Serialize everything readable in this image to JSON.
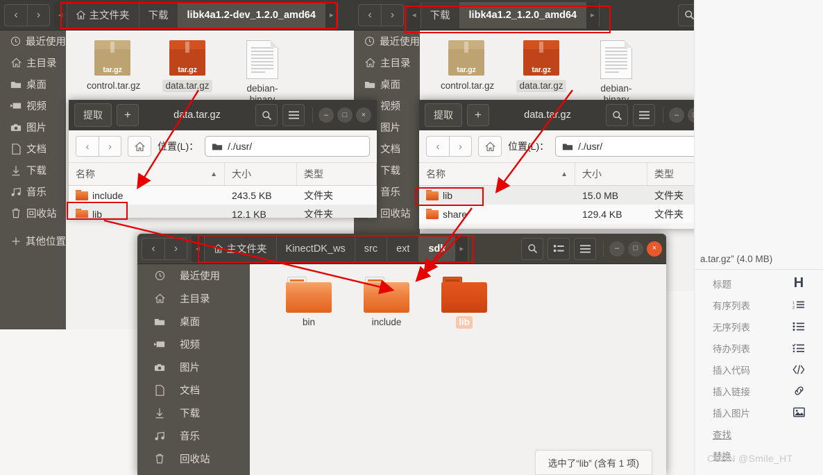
{
  "window_left": {
    "breadcrumbs": [
      {
        "label": "主文件夹",
        "icon": "home-icon",
        "current": false
      },
      {
        "label": "下载",
        "icon": null,
        "current": false
      },
      {
        "label": "libk4a1.2-dev_1.2.0_amd64",
        "icon": null,
        "current": true
      }
    ],
    "nav": {
      "back": "‹",
      "forward": "›",
      "prev_crumb": "◂",
      "next_crumb": "▸"
    },
    "sidebar": [
      {
        "label": "最近使用",
        "icon": "clock-icon"
      },
      {
        "label": "主目录",
        "icon": "home-icon"
      },
      {
        "label": "桌面",
        "icon": "folder-icon"
      },
      {
        "label": "视频",
        "icon": "video-icon"
      },
      {
        "label": "图片",
        "icon": "camera-icon"
      },
      {
        "label": "文档",
        "icon": "document-icon"
      },
      {
        "label": "下载",
        "icon": "download-icon"
      },
      {
        "label": "音乐",
        "icon": "music-icon"
      },
      {
        "label": "回收站",
        "icon": "trash-icon"
      },
      {
        "label": "其他位置",
        "icon": "plus-icon"
      }
    ],
    "files": [
      {
        "label": "control.tar.gz",
        "icon": "targz-tan-icon",
        "badge": "tar.gz",
        "selected": false
      },
      {
        "label": "data.tar.gz",
        "icon": "targz-red-icon",
        "badge": "tar.gz",
        "selected": true
      },
      {
        "label": "debian-binary",
        "icon": "text-document-icon",
        "badge": "",
        "selected": false
      }
    ]
  },
  "window_right": {
    "breadcrumbs": [
      {
        "label": "下载",
        "icon": null,
        "current": false
      },
      {
        "label": "libk4a1.2_1.2.0_amd64",
        "icon": null,
        "current": true
      }
    ],
    "nav": {
      "back": "‹",
      "forward": "›",
      "prev_crumb": "◂",
      "next_crumb": "▸"
    },
    "toolbar": {
      "search": "search-icon",
      "view": "list-view-icon",
      "menu": "hamburger-icon"
    },
    "controls": {
      "minimize": "–",
      "maximize": "□",
      "close": "×"
    },
    "sidebar": [
      {
        "label": "最近使用",
        "icon": "clock-icon"
      },
      {
        "label": "主目录",
        "icon": "home-icon"
      },
      {
        "label": "桌面",
        "icon": "folder-icon"
      },
      {
        "label": "视频",
        "icon": "video-icon"
      },
      {
        "label": "图片",
        "icon": "camera-icon"
      },
      {
        "label": "文档",
        "icon": "document-icon"
      },
      {
        "label": "下载",
        "icon": "download-icon"
      },
      {
        "label": "音乐",
        "icon": "music-icon"
      },
      {
        "label": "回收站",
        "icon": "trash-icon"
      }
    ],
    "files": [
      {
        "label": "control.tar.gz",
        "icon": "targz-tan-icon",
        "badge": "tar.gz",
        "selected": false
      },
      {
        "label": "data.tar.gz",
        "icon": "targz-red-icon",
        "badge": "tar.gz",
        "selected": true
      },
      {
        "label": "debian-binary",
        "icon": "text-document-icon",
        "badge": "",
        "selected": false
      }
    ]
  },
  "archive_left": {
    "title": "data.tar.gz",
    "extract_label": "提取",
    "add_label": "+",
    "search_icon": "search-icon",
    "menu_icon": "hamburger-icon",
    "controls": {
      "minimize": "–",
      "maximize": "□",
      "close": "×"
    },
    "location_label": "位置(L)：",
    "location_value": "/./usr/",
    "columns": {
      "name": "名称",
      "size": "大小",
      "type": "类型",
      "sort": "▲"
    },
    "rows": [
      {
        "name": "include",
        "size": "243.5 KB",
        "type": "文件夹",
        "selected": false
      },
      {
        "name": "lib",
        "size": "12.1 KB",
        "type": "文件夹",
        "selected": true
      }
    ]
  },
  "archive_right": {
    "title": "data.tar.gz",
    "extract_label": "提取",
    "add_label": "+",
    "search_icon": "search-icon",
    "menu_icon": "hamburger-icon",
    "controls": {
      "minimize": "–",
      "maximize": "□",
      "close": "×"
    },
    "location_label": "位置(L)：",
    "location_value": "/./usr/",
    "columns": {
      "name": "名称",
      "size": "大小",
      "type": "类型",
      "sort": "▲"
    },
    "rows": [
      {
        "name": "lib",
        "size": "15.0 MB",
        "type": "文件夹",
        "selected": true
      },
      {
        "name": "share",
        "size": "129.4 KB",
        "type": "文件夹",
        "selected": false
      }
    ]
  },
  "file_manager": {
    "breadcrumbs": [
      {
        "label": "主文件夹",
        "icon": "home-icon",
        "current": false
      },
      {
        "label": "KinectDK_ws",
        "icon": null,
        "current": false
      },
      {
        "label": "src",
        "icon": null,
        "current": false
      },
      {
        "label": "ext",
        "icon": null,
        "current": false
      },
      {
        "label": "sdk",
        "icon": null,
        "current": true
      }
    ],
    "nav": {
      "back": "‹",
      "forward": "›",
      "prev_crumb": "◂",
      "next_crumb": "▸"
    },
    "toolbar": {
      "search": "search-icon",
      "view": "list-view-icon",
      "menu": "hamburger-icon"
    },
    "controls": {
      "minimize": "–",
      "maximize": "□",
      "close": "×"
    },
    "sidebar": [
      {
        "label": "最近使用",
        "icon": "clock-icon"
      },
      {
        "label": "主目录",
        "icon": "home-icon"
      },
      {
        "label": "桌面",
        "icon": "folder-icon"
      },
      {
        "label": "视频",
        "icon": "video-icon"
      },
      {
        "label": "图片",
        "icon": "camera-icon"
      },
      {
        "label": "文档",
        "icon": "document-icon"
      },
      {
        "label": "下载",
        "icon": "download-icon"
      },
      {
        "label": "音乐",
        "icon": "music-icon"
      },
      {
        "label": "回收站",
        "icon": "trash-icon"
      }
    ],
    "folders": [
      {
        "label": "bin",
        "selected": false
      },
      {
        "label": "include",
        "selected": false
      },
      {
        "label": "lib",
        "selected": true
      }
    ],
    "status": "选中了“lib” (含有 1 项)"
  },
  "editor_panel": {
    "file_size_text": "a.tar.gz” (4.0 MB)",
    "items": [
      {
        "label": "标题",
        "icon": "heading-icon",
        "link": false
      },
      {
        "label": "有序列表",
        "icon": "ordered-list-icon",
        "link": false
      },
      {
        "label": "无序列表",
        "icon": "unordered-list-icon",
        "link": false
      },
      {
        "label": "待办列表",
        "icon": "todo-list-icon",
        "link": false
      },
      {
        "label": "插入代码",
        "icon": "code-icon",
        "link": false
      },
      {
        "label": "插入链接",
        "icon": "link-icon",
        "link": false
      },
      {
        "label": "插入图片",
        "icon": "image-icon",
        "link": false
      },
      {
        "label": "查找",
        "icon": null,
        "link": true
      },
      {
        "label": "替换",
        "icon": null,
        "link": true
      }
    ],
    "watermark": "CSDN @Smile_HT"
  },
  "colors": {
    "annotation_red": "#e60000",
    "titlebar": "#3c3b37",
    "sidebar": "#56534c",
    "accent_orange": "#e8582b",
    "folder_orange": "#e0631d"
  }
}
